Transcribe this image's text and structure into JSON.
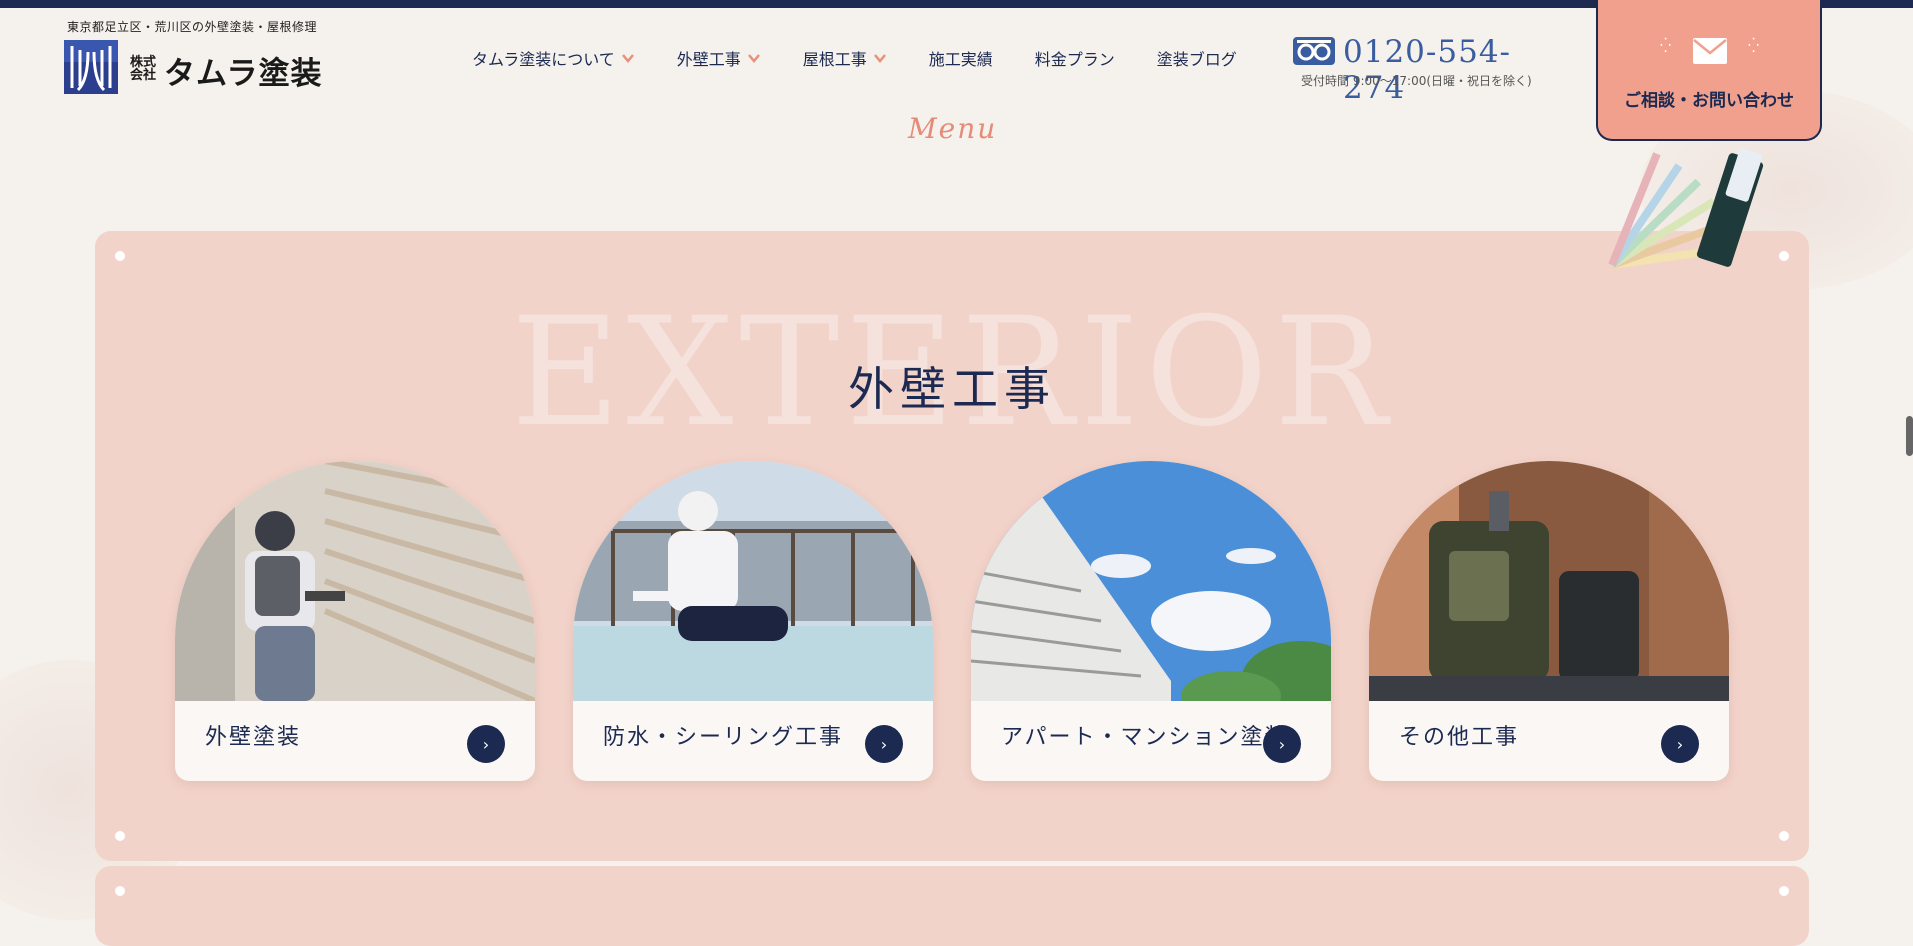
{
  "header": {
    "tagline": "東京都足立区・荒川区の外壁塗装・屋根修理",
    "logo_company_prefix": "株式会社",
    "logo_name": "タムラ塗装",
    "nav": [
      {
        "label": "タムラ塗装について",
        "dropdown": true
      },
      {
        "label": "外壁工事",
        "dropdown": true
      },
      {
        "label": "屋根工事",
        "dropdown": true
      },
      {
        "label": "施工実績",
        "dropdown": false
      },
      {
        "label": "料金プラン",
        "dropdown": false
      },
      {
        "label": "塗装ブログ",
        "dropdown": false
      }
    ],
    "phone": {
      "number": "0120-554-274",
      "hours": "受付時間 9:00〜17:00(日曜・祝日を除く)",
      "icon": "free-dial-icon"
    },
    "contact_button": {
      "label": "ご相談・お問い合わせ",
      "icon": "mail-icon"
    }
  },
  "menu_script": "Menu",
  "section": {
    "bg_word": "EXTERIOR",
    "title": "外壁工事",
    "cards": [
      {
        "label": "外壁塗装",
        "image": "painter-on-siding"
      },
      {
        "label": "防水・シーリング工事",
        "image": "worker-on-rooftop"
      },
      {
        "label": "アパート・マンション塗装",
        "image": "apartment-building-sky"
      },
      {
        "label": "その他工事",
        "image": "tool-bags"
      }
    ]
  },
  "colors": {
    "navy": "#1c2a52",
    "accent": "#f0a08c",
    "panel": "#f2d3c9",
    "background": "#f5f1ec"
  }
}
